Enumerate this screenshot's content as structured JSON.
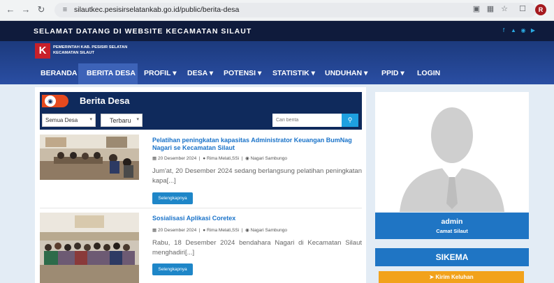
{
  "browser": {
    "url": "silautkec.pesisirselatankab.go.id/public/berita-desa",
    "profile_initial": "R"
  },
  "topbar": {
    "welcome": "SELAMAT DATANG DI WEBSITE KECAMATAN SILAUT",
    "social_icons": [
      "facebook-icon",
      "twitter-icon",
      "instagram-icon",
      "youtube-icon"
    ]
  },
  "header": {
    "logo_letter": "K",
    "logo_line1": "PEMERINTAH KAB. PESISIR SELATAN",
    "logo_line2": "KECAMATAN SILAUT"
  },
  "menu": [
    {
      "label": "BERANDA"
    },
    {
      "label": "BERITA DESA"
    },
    {
      "label": "PROFIL ▾"
    },
    {
      "label": "DESA ▾"
    },
    {
      "label": "POTENSI ▾"
    },
    {
      "label": "STATISTIK ▾"
    },
    {
      "label": "UNDUHAN ▾"
    },
    {
      "label": "PPID ▾"
    },
    {
      "label": "LOGIN"
    }
  ],
  "section": {
    "title": "Berita Desa"
  },
  "filters": {
    "desa_selected": "Semua Desa",
    "sort_selected": "Terbaru",
    "search_placeholder": "Cari berita"
  },
  "posts": [
    {
      "title": "Pelatihan peningkatan kapasitas Administrator Keuangan BumNag Nagari se Kecamatan Silaut",
      "date": "20 Desember 2024",
      "author": "Rima Melati,SSi",
      "location": "Nagari Sambungo",
      "excerpt": "Jum'at, 20 Desember 2024 sedang berlangsung pelatihan peningkatan kapa[...]",
      "button": "Selengkapnya"
    },
    {
      "title": "Sosialisasi Aplikasi Coretex",
      "date": "20 Desember 2024",
      "author": "Rima Melati,SSi",
      "location": "Nagari Sambungo",
      "excerpt": "Rabu, 18 Desember 2024 bendahara Nagari di Kecamatan Silaut menghadiri[...]",
      "button": "Selengkapnya"
    }
  ],
  "sidebar": {
    "name": "admin",
    "role": "Camat Silaut",
    "sikema": "SIKEMA",
    "complaint_button": "Kirim Keluhan"
  },
  "colors": {
    "topbar": "#0f1b3c",
    "header": "#2a4ea3",
    "accent_blue": "#1f75c4",
    "accent_orange": "#f2a21b",
    "logo_red": "#c8202a"
  }
}
